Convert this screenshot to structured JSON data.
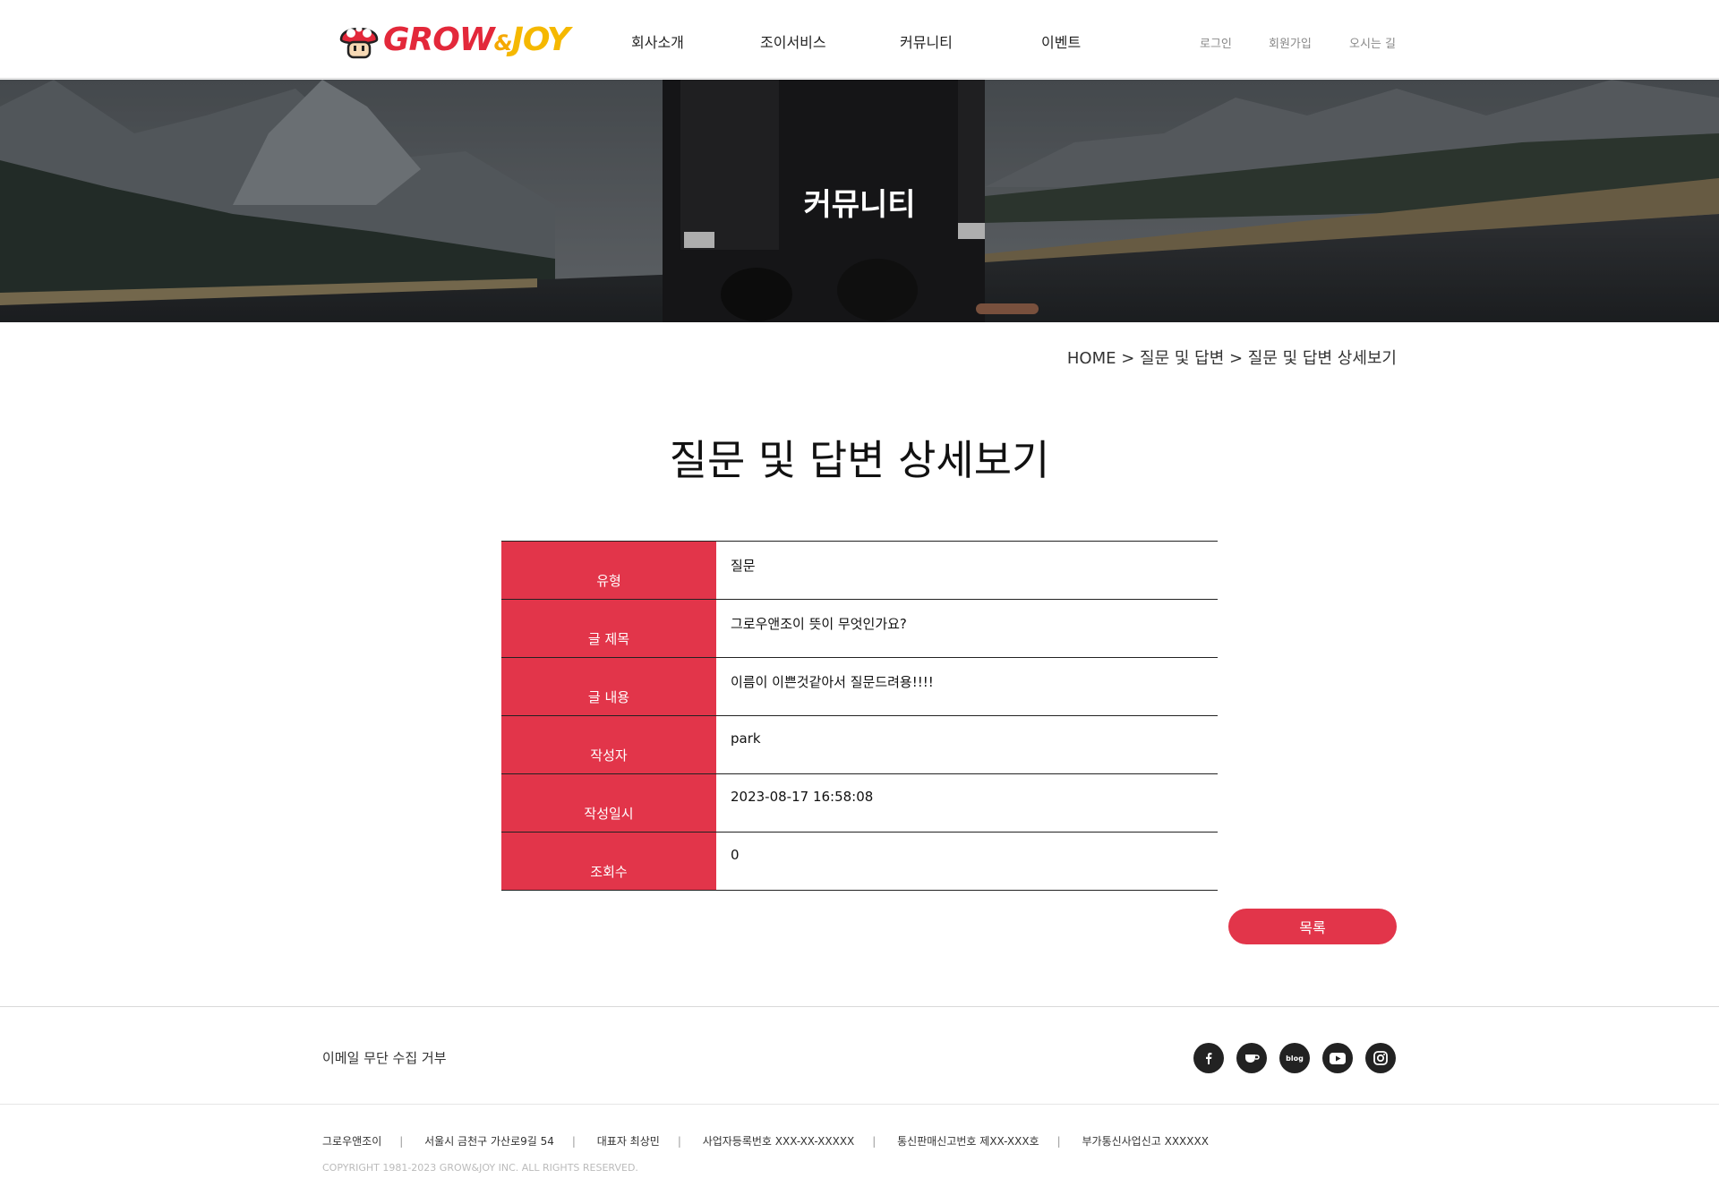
{
  "header": {
    "logo_text_grow": "GROW",
    "logo_text_amp": "&",
    "logo_text_joy": "JOY",
    "nav": [
      "회사소개",
      "조이서비스",
      "커뮤니티",
      "이벤트"
    ],
    "util": [
      "로그인",
      "회원가입",
      "오시는 길"
    ]
  },
  "hero": {
    "title": "커뮤니티"
  },
  "breadcrumb": "HOME > 질문 및 답변 > 질문 및 답변 상세보기",
  "page_title": "질문 및 답변 상세보기",
  "detail": [
    {
      "label": "유형",
      "value": "질문"
    },
    {
      "label": "글 제목",
      "value": "그로우앤조이 뜻이 무엇인가요?"
    },
    {
      "label": "글 내용",
      "value": "이름이 이쁜것같아서 질문드려용!!!!"
    },
    {
      "label": "작성자",
      "value": "park"
    },
    {
      "label": "작성일시",
      "value": "2023-08-17 16:58:08"
    },
    {
      "label": "조회수",
      "value": "0"
    }
  ],
  "list_button": "목록",
  "footer": {
    "email_refuse": "이메일 무단 수집 거부",
    "social": [
      "facebook-icon",
      "cafe-icon",
      "blog-icon",
      "youtube-icon",
      "instagram-icon"
    ],
    "blog_label": "blog",
    "info": [
      "그로우앤조이",
      "서울시 금천구 가산로9길 54",
      "대표자 최상민",
      "사업자등록번호 XXX-XX-XXXXX",
      "통신판매신고번호 제XX-XXX호",
      "부가통신사업신고 XXXXXX"
    ],
    "separator": "|",
    "copyright": "COPYRIGHT 1981-2023 GROW&JOY INC. ALL RIGHTS RESERVED."
  },
  "colors": {
    "accent": "#e2354a",
    "logo_red": "#e3283a",
    "logo_yellow": "#f5b800"
  }
}
